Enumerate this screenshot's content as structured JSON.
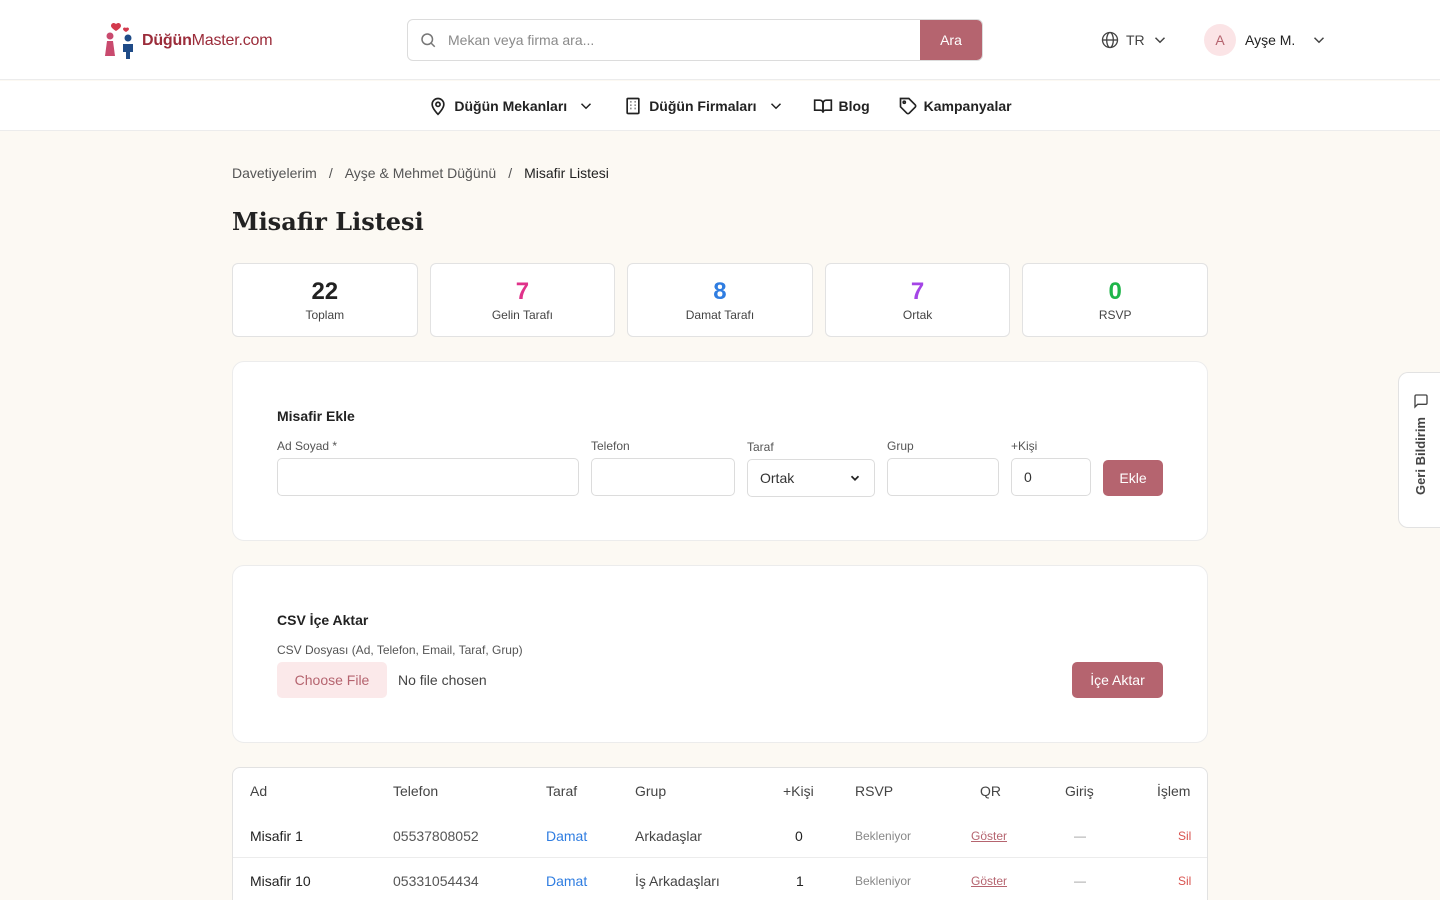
{
  "header": {
    "logo_strong": "Düğün",
    "logo_rest": "Master.com",
    "search_placeholder": "Mekan veya firma ara...",
    "search_button": "Ara",
    "language": "TR",
    "user_initial": "A",
    "user_name": "Ayşe M."
  },
  "nav": [
    {
      "label": "Düğün Mekanları",
      "icon": "map-pin-icon"
    },
    {
      "label": "Düğün Firmaları",
      "icon": "building-icon"
    },
    {
      "label": "Blog",
      "icon": "book-icon"
    },
    {
      "label": "Kampanyalar",
      "icon": "tag-icon"
    }
  ],
  "breadcrumb": [
    "Davetiyelerim",
    "Ayşe & Mehmet Düğünü",
    "Misafir Listesi"
  ],
  "breadcrumb_sep": "/",
  "page_title": "Misafir Listesi",
  "stats": [
    {
      "value": "22",
      "label": "Toplam",
      "color": "#222222"
    },
    {
      "value": "7",
      "label": "Gelin Tarafı",
      "color": "#e0328a"
    },
    {
      "value": "8",
      "label": "Damat Tarafı",
      "color": "#2f7de1"
    },
    {
      "value": "7",
      "label": "Ortak",
      "color": "#a445e6"
    },
    {
      "value": "0",
      "label": "RSVP",
      "color": "#1fb54a"
    }
  ],
  "add_form": {
    "title": "Misafir Ekle",
    "name_label": "Ad Soyad *",
    "phone_label": "Telefon",
    "side_label": "Taraf",
    "side_value": "Ortak",
    "group_label": "Grup",
    "plus_label": "+Kişi",
    "plus_value": "0",
    "submit": "Ekle"
  },
  "csv": {
    "title": "CSV İçe Aktar",
    "file_label": "CSV Dosyası (Ad, Telefon, Email, Taraf, Grup)",
    "choose_file": "Choose File",
    "no_file": "No file chosen",
    "import_button": "İçe Aktar"
  },
  "table": {
    "headers": {
      "name": "Ad",
      "phone": "Telefon",
      "side": "Taraf",
      "group": "Grup",
      "plus": "+Kişi",
      "rsvp": "RSVP",
      "qr": "QR",
      "checkin": "Giriş",
      "action": "İşlem"
    },
    "rows": [
      {
        "name": "Misafir 1",
        "phone": "05537808052",
        "side": "Damat",
        "group": "Arkadaşlar",
        "plus": "0",
        "rsvp": "Bekleniyor",
        "qr": "Göster",
        "checkin": "—",
        "action": "Sil"
      },
      {
        "name": "Misafir 10",
        "phone": "05331054434",
        "side": "Damat",
        "group": "İş Arkadaşları",
        "plus": "1",
        "rsvp": "Bekleniyor",
        "qr": "Göster",
        "checkin": "—",
        "action": "Sil"
      }
    ]
  },
  "feedback": "Geri Bildirim",
  "colors": {
    "accent": "#b5646f",
    "logo": "#9b2c3a"
  }
}
